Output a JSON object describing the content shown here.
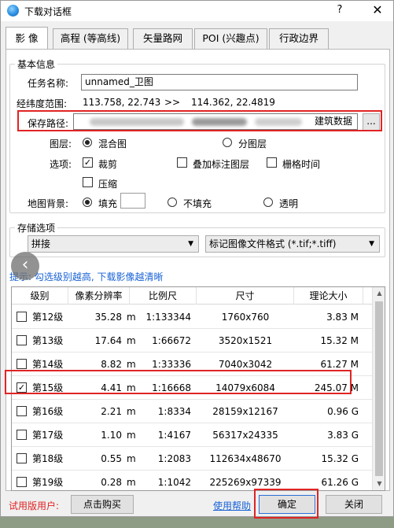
{
  "window": {
    "title": "下载对话框",
    "help_label": "?",
    "close_label": "✕",
    "icon": "globe-icon"
  },
  "tabs": [
    {
      "label": "影 像",
      "active": true
    },
    {
      "label": "高程 (等高线)",
      "active": false
    },
    {
      "label": "矢量路网",
      "active": false
    },
    {
      "label": "POI (兴趣点)",
      "active": false
    },
    {
      "label": "行政边界",
      "active": false
    }
  ],
  "basic_info": {
    "legend": "基本信息",
    "task_name_label": "任务名称:",
    "task_name_value": "unnamed_卫图",
    "range_label": "经纬度范围:",
    "range_from": "113.758, 22.743",
    "range_arrow": ">>",
    "range_to": "114.362, 22.4819",
    "save_path_label": "保存路径:",
    "save_path_tail": "建筑数据",
    "browse_label": "...",
    "layer_label": "图层:",
    "layer_options": [
      {
        "label": "混合图",
        "checked": true
      },
      {
        "label": "分图层",
        "checked": false
      }
    ],
    "options_label": "选项:",
    "option_crop": {
      "label": "裁剪",
      "checked": true
    },
    "option_overlay": {
      "label": "叠加标注图层",
      "checked": false
    },
    "option_grid": {
      "label": "栅格时间",
      "checked": false
    },
    "option_compress": {
      "label": "压缩",
      "checked": false
    },
    "map_bg_label": "地图背景:",
    "bg_options": [
      {
        "label": "填充",
        "checked": true
      },
      {
        "label": "不填充",
        "checked": false
      },
      {
        "label": "透明",
        "checked": false
      }
    ],
    "fill_color": "#ffffff"
  },
  "storage": {
    "legend": "存储选项",
    "mode_value": "拼接",
    "format_value": "标记图像文件格式 (*.tif;*.tiff)",
    "hint": "提示: 勾选级别越高, 下载影像越清晰"
  },
  "table": {
    "headers": [
      "级别",
      "像素分辨率",
      "比例尺",
      "尺寸",
      "理论大小"
    ],
    "rows": [
      {
        "checked": false,
        "level": "第12级",
        "res": "35.28",
        "unit": "m",
        "scale": "1:133344",
        "size": "1760x760",
        "file": "3.83 M"
      },
      {
        "checked": false,
        "level": "第13级",
        "res": "17.64",
        "unit": "m",
        "scale": "1:66672",
        "size": "3520x1521",
        "file": "15.32 M"
      },
      {
        "checked": false,
        "level": "第14级",
        "res": "8.82",
        "unit": "m",
        "scale": "1:33336",
        "size": "7040x3042",
        "file": "61.27 M"
      },
      {
        "checked": true,
        "level": "第15级",
        "res": "4.41",
        "unit": "m",
        "scale": "1:16668",
        "size": "14079x6084",
        "file": "245.07 M"
      },
      {
        "checked": false,
        "level": "第16级",
        "res": "2.21",
        "unit": "m",
        "scale": "1:8334",
        "size": "28159x12167",
        "file": "0.96 G"
      },
      {
        "checked": false,
        "level": "第17级",
        "res": "1.10",
        "unit": "m",
        "scale": "1:4167",
        "size": "56317x24335",
        "file": "3.83 G"
      },
      {
        "checked": false,
        "level": "第18级",
        "res": "0.55",
        "unit": "m",
        "scale": "1:2083",
        "size": "112634x48670",
        "file": "15.32 G"
      },
      {
        "checked": false,
        "level": "第19级",
        "res": "0.28",
        "unit": "m",
        "scale": "1:1042",
        "size": "225269x97339",
        "file": "61.26 G"
      }
    ]
  },
  "footer": {
    "trial_label": "试用版用户:",
    "buy_label": "点击购买",
    "help_link": "使用帮助",
    "ok_label": "确定",
    "close_label": "关闭"
  },
  "colors": {
    "highlight": "#e02424",
    "link": "#1862d6"
  }
}
